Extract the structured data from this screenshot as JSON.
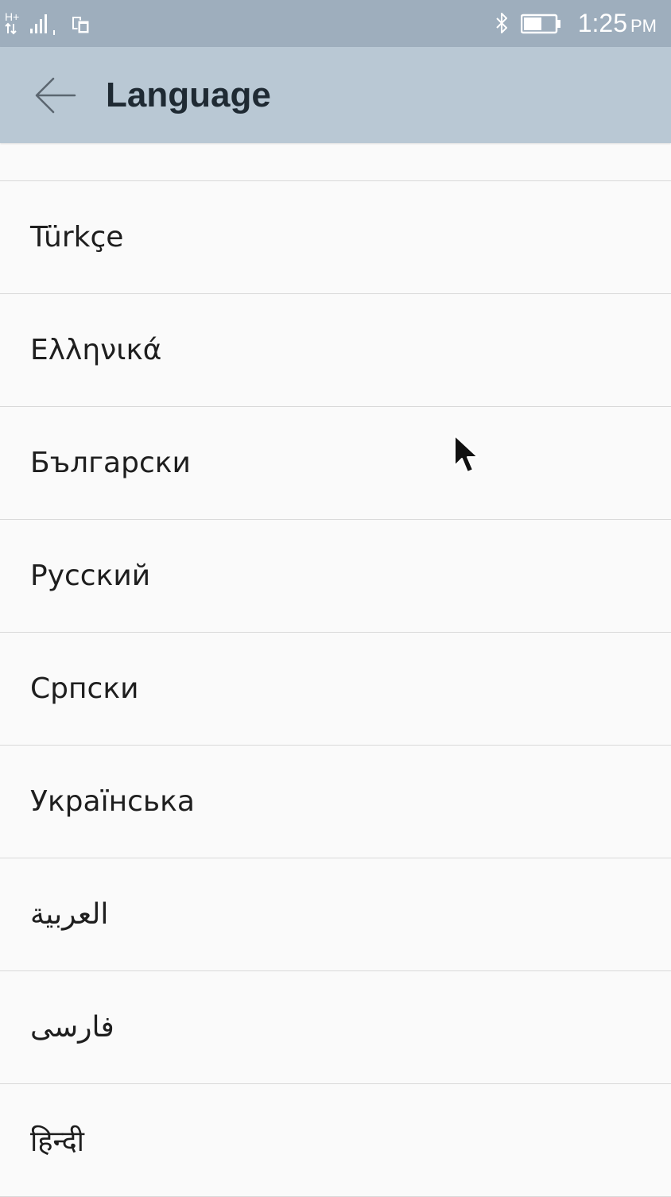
{
  "status_bar": {
    "network": "H+",
    "time": "1:25",
    "ampm": "PM",
    "icons": [
      "network-type-icon",
      "signal-icon",
      "sim-icon",
      "bluetooth-icon",
      "battery-icon"
    ]
  },
  "app_bar": {
    "back_icon": "arrow-left-icon",
    "title": "Language"
  },
  "languages": [
    {
      "label": "Türkçe"
    },
    {
      "label": "Ελληνικά"
    },
    {
      "label": "Български"
    },
    {
      "label": "Русский"
    },
    {
      "label": "Српски"
    },
    {
      "label": "Українська"
    },
    {
      "label": "العربية"
    },
    {
      "label": "فارسی"
    },
    {
      "label": "हिन्दी"
    }
  ],
  "colors": {
    "status_bar": "#9eaebd",
    "app_bar": "#b9c8d4",
    "background": "#fafafa",
    "divider": "#d9d9d9"
  }
}
